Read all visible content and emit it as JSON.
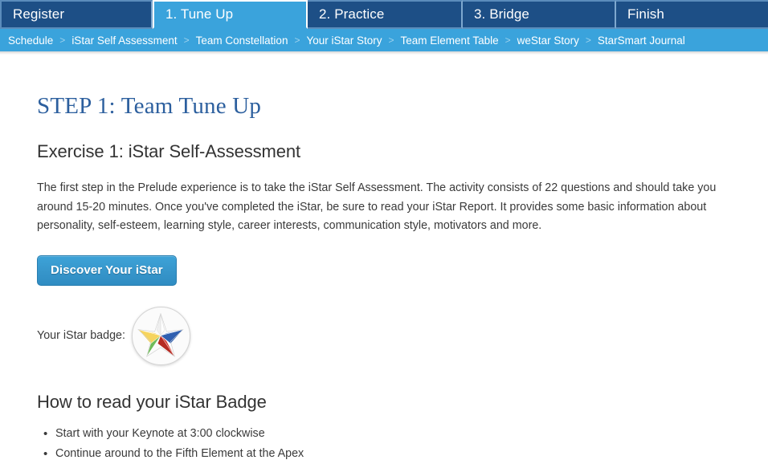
{
  "tabs": [
    {
      "label": "Register",
      "active": false,
      "name": "tab-register"
    },
    {
      "label": "1. Tune Up",
      "active": true,
      "name": "tab-tune-up"
    },
    {
      "label": "2. Practice",
      "active": false,
      "name": "tab-practice"
    },
    {
      "label": "3. Bridge",
      "active": false,
      "name": "tab-bridge"
    },
    {
      "label": "Finish",
      "active": false,
      "name": "tab-finish"
    }
  ],
  "breadcrumb": {
    "separator": ">",
    "items": [
      "Schedule",
      "iStar Self Assessment",
      "Team Constellation",
      "Your iStar Story",
      "Team Element Table",
      "weStar Story",
      "StarSmart Journal"
    ]
  },
  "main": {
    "step_title": "STEP 1: Team Tune Up",
    "exercise_title": "Exercise 1: iStar Self-Assessment",
    "intro_paragraph": "The first step in the Prelude experience is to take the iStar Self Assessment. The activity consists of 22 questions and should take you around 15-20 minutes. Once you've completed the iStar, be sure to read your iStar Report. It provides some basic information about personality, self-esteem, learning style, career interests, communication style, motivators and more.",
    "discover_button_label": "Discover Your iStar",
    "badge_label": "Your iStar badge:",
    "howto_title": "How to read your iStar Badge",
    "howto_items": [
      "Start with your Keynote at 3:00 clockwise",
      "Continue around to the Fifth Element at the Apex"
    ]
  },
  "badge": {
    "name": "istar-badge",
    "points": [
      {
        "position": "apex",
        "light": "#ffffff",
        "dark": "#e9e9e9"
      },
      {
        "position": "upper-right",
        "light": "#4a7fd0",
        "dark": "#2f5fb0"
      },
      {
        "position": "lower-right",
        "light": "#d8382f",
        "dark": "#b52a22"
      },
      {
        "position": "lower-left",
        "light": "#4aa544",
        "dark": "#35872f"
      },
      {
        "position": "upper-left",
        "light": "#f2c230",
        "dark": "#dca915"
      }
    ]
  },
  "colors": {
    "tabbar_bg": "#1b4a7e",
    "tab_bg": "#1d4f86",
    "tab_active_bg": "#3aa3dc",
    "breadcrumb_bg": "#3aa3dc",
    "step_title": "#2c5f9e",
    "button_blue": "#3796cb",
    "body_text": "#3a3a3a"
  }
}
